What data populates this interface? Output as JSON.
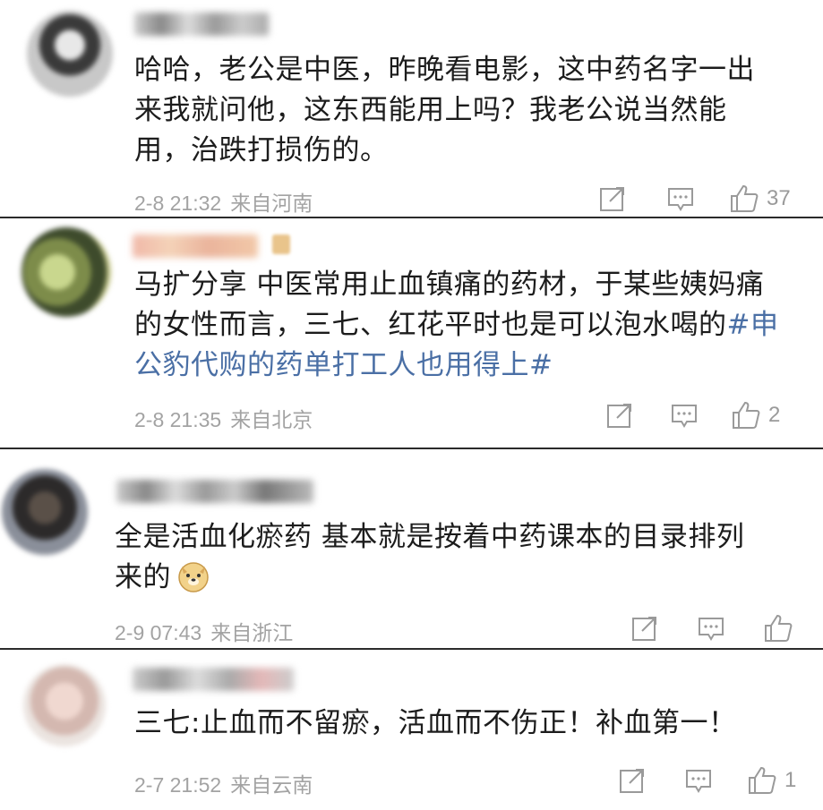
{
  "comments": [
    {
      "text": "哈哈，老公是中医，昨晚看电影，这中药名字一出\n来我就问他，这东西能用上吗？我老公说当然能\n用，治跌打损伤的。",
      "date": "2-8 21:32",
      "location": "来自河南",
      "likes": "37"
    },
    {
      "text_before": "马扩分享 中医常用止血镇痛的药材，于某些姨妈痛\n的女性而言，三七、红花平时也是可以泡水喝的",
      "hashtag": "#申\n公豹代购的药单打工人也用得上#",
      "date": "2-8 21:35",
      "location": "来自北京",
      "likes": "2"
    },
    {
      "text": "全是活血化瘀药 基本就是按着中药课本的目录排列\n来的",
      "emoji": "doge-emoji",
      "date": "2-9 07:43",
      "location": "来自浙江",
      "likes": ""
    },
    {
      "text": "三七:止血而不留瘀，活血而不伤正！补血第一！",
      "date": "2-7 21:52",
      "location": "来自云南",
      "likes": "1"
    }
  ],
  "icons": {
    "share": "share-icon",
    "reply": "comment-icon",
    "like": "thumbs-up-icon"
  },
  "colors": {
    "hashtag": "#4a6fa5",
    "meta": "#a3a3a3",
    "divider": "#2b2b2b"
  }
}
